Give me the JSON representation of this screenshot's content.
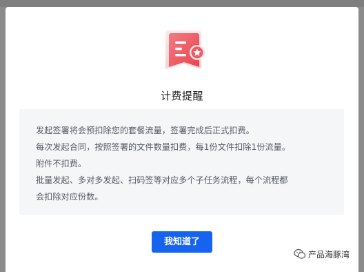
{
  "dialog": {
    "title": "计费提醒",
    "lines": [
      "发起签署将会预扣除您的套餐流量，签署完成后正式扣费。",
      "每次发起合同，按照签署的文件数量扣费，每1份文件扣除1份流量。",
      "附件不扣费。",
      "批量发起、多对多发起、扫码签等对应多个子任务流程，每个流程都",
      "会扣除对应份数。"
    ],
    "confirm_label": "我知道了",
    "icon": "document-star-icon"
  },
  "watermark": {
    "text": "产品海豚湾",
    "icon": "wechat-icon"
  },
  "colors": {
    "primary": "#1663f0",
    "icon_red": "#f05a63",
    "panel_bg": "#f5f6f8",
    "backdrop": "#8b8b8b"
  }
}
